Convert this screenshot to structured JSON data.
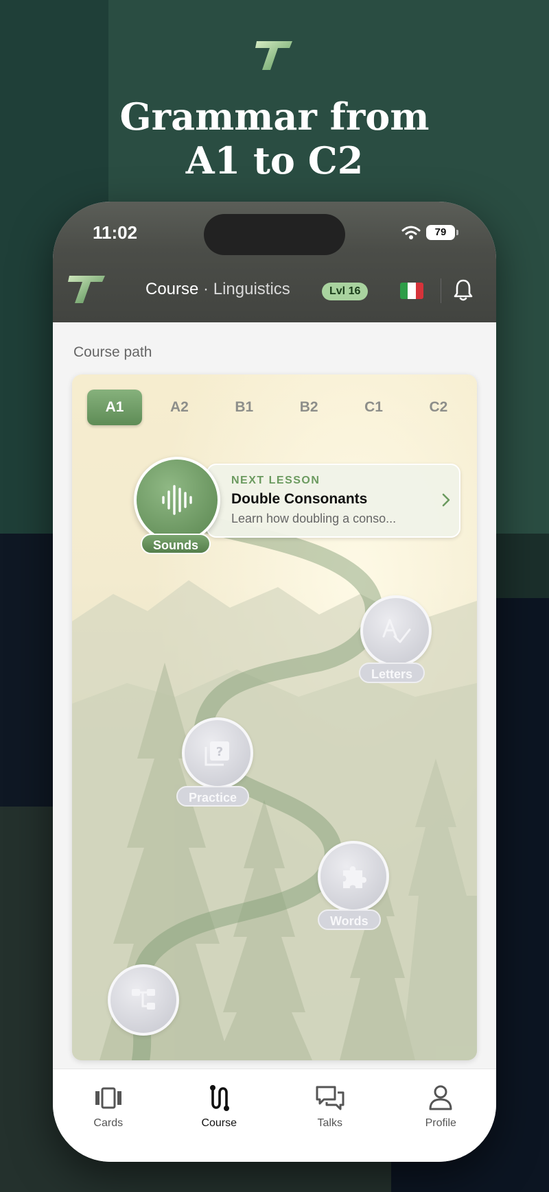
{
  "promo": {
    "headline_line1": "Grammar from",
    "headline_line2": "A1 to C2"
  },
  "status_bar": {
    "time": "11:02",
    "battery": "79"
  },
  "header": {
    "title": "Course",
    "separator": "·",
    "subtitle": "Linguistics",
    "level_badge": "Lvl 16",
    "flag": "italy-flag",
    "notification_icon": "bell-icon"
  },
  "course": {
    "section_label": "Course path",
    "levels": [
      {
        "label": "A1",
        "active": true
      },
      {
        "label": "A2",
        "active": false
      },
      {
        "label": "B1",
        "active": false
      },
      {
        "label": "B2",
        "active": false
      },
      {
        "label": "C1",
        "active": false
      },
      {
        "label": "C2",
        "active": false
      }
    ],
    "next_lesson": {
      "kicker": "NEXT LESSON",
      "title": "Double Consonants",
      "description": "Learn how doubling a conso..."
    },
    "nodes": [
      {
        "label": "Sounds",
        "icon": "waveform-icon",
        "state": "active"
      },
      {
        "label": "Letters",
        "icon": "spelling-check-icon",
        "state": "locked"
      },
      {
        "label": "Practice",
        "icon": "question-card-icon",
        "state": "locked"
      },
      {
        "label": "Words",
        "icon": "puzzle-icon",
        "state": "locked"
      },
      {
        "label": "",
        "icon": "structure-icon",
        "state": "locked"
      }
    ]
  },
  "bottom_nav": [
    {
      "label": "Cards",
      "icon": "cards-icon",
      "active": false
    },
    {
      "label": "Course",
      "icon": "path-icon",
      "active": true
    },
    {
      "label": "Talks",
      "icon": "chat-icon",
      "active": false
    },
    {
      "label": "Profile",
      "icon": "person-icon",
      "active": false
    }
  ],
  "colors": {
    "accent_green": "#6b9a5f",
    "background_green": "#2a4d42",
    "badge_green": "#a9d39f"
  }
}
